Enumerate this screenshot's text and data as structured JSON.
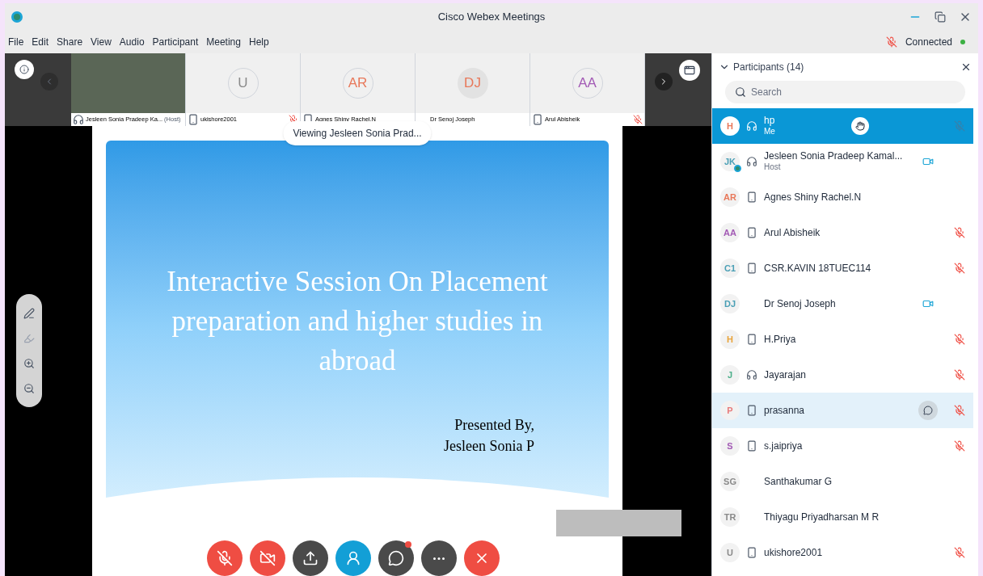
{
  "window": {
    "title": "Cisco Webex Meetings",
    "status": "Connected",
    "status_muted": true
  },
  "menu": [
    "File",
    "Edit",
    "Share",
    "View",
    "Audio",
    "Participant",
    "Meeting",
    "Help"
  ],
  "video_strip": [
    {
      "kind": "video",
      "name": "Jesleen Sonia Pradeep Ka...",
      "role": "(Host)",
      "headset": true,
      "phone": false,
      "muted": false
    },
    {
      "kind": "avatar",
      "initials": "U",
      "color": "#8a8a8a",
      "name": "ukishore2001",
      "headset": false,
      "phone": true,
      "muted": true
    },
    {
      "kind": "avatar",
      "initials": "AR",
      "color": "#e8785a",
      "name": "Agnes Shiny Rachel.N",
      "headset": false,
      "phone": true,
      "muted": false
    },
    {
      "kind": "avatar",
      "initials": "DJ",
      "color": "#e8785a",
      "name": "Dr Senoj Joseph",
      "headset": false,
      "phone": false,
      "muted": false
    },
    {
      "kind": "avatar",
      "initials": "AA",
      "color": "#a35bb5",
      "name": "Arul Abisheik",
      "headset": false,
      "phone": true,
      "muted": true
    }
  ],
  "viewing_label": "Viewing Jesleen Sonia Prad...",
  "slide": {
    "title": "Interactive Session On Placement preparation and higher studies in abroad",
    "presenter": [
      "Presented By,",
      "Jesleen Sonia P"
    ]
  },
  "toolbar": [
    {
      "kind": "mute"
    },
    {
      "kind": "video"
    },
    {
      "kind": "share"
    },
    {
      "kind": "participants"
    },
    {
      "kind": "chat",
      "notification": true
    },
    {
      "kind": "more"
    },
    {
      "kind": "leave"
    }
  ],
  "participants": {
    "title": "Participants (14)",
    "expanded": true,
    "search": {
      "placeholder": "Search"
    },
    "items": [
      {
        "initials": "H",
        "color": "#e8785a",
        "name": "hp",
        "subtitle": "Me",
        "headset": true,
        "phone": false,
        "presenter": false,
        "muted": true,
        "video": false,
        "hand_raised": true,
        "chat": false,
        "selected": true,
        "highlighted": false
      },
      {
        "initials": "JK",
        "color": "#4a9fb5",
        "name": "Jesleen Sonia Pradeep Kamal...",
        "subtitle": "Host",
        "headset": true,
        "phone": false,
        "presenter": true,
        "muted": false,
        "video": true,
        "hand_raised": false,
        "chat": false,
        "selected": false,
        "highlighted": false
      },
      {
        "initials": "AR",
        "color": "#e8785a",
        "name": "Agnes Shiny Rachel.N",
        "headset": false,
        "phone": true,
        "presenter": false,
        "muted": false,
        "video": false,
        "hand_raised": false,
        "chat": false,
        "selected": false,
        "highlighted": false
      },
      {
        "initials": "AA",
        "color": "#a35bb5",
        "name": "Arul Abisheik",
        "headset": false,
        "phone": true,
        "presenter": false,
        "muted": true,
        "video": false,
        "hand_raised": false,
        "chat": false,
        "selected": false,
        "highlighted": false
      },
      {
        "initials": "C1",
        "color": "#4a9fb5",
        "name": "CSR.KAVIN 18TUEC114",
        "headset": false,
        "phone": true,
        "presenter": false,
        "muted": true,
        "video": false,
        "hand_raised": false,
        "chat": false,
        "selected": false,
        "highlighted": false
      },
      {
        "initials": "DJ",
        "color": "#4a9fb5",
        "name": "Dr Senoj Joseph",
        "headset": false,
        "phone": false,
        "presenter": false,
        "muted": false,
        "video": true,
        "hand_raised": false,
        "chat": false,
        "selected": false,
        "highlighted": false
      },
      {
        "initials": "H",
        "color": "#e8a33a",
        "name": "H.Priya",
        "headset": false,
        "phone": true,
        "presenter": false,
        "muted": true,
        "video": false,
        "hand_raised": false,
        "chat": false,
        "selected": false,
        "highlighted": false
      },
      {
        "initials": "J",
        "color": "#4caf8a",
        "name": "Jayarajan",
        "headset": true,
        "phone": false,
        "presenter": false,
        "muted": true,
        "video": false,
        "hand_raised": false,
        "chat": false,
        "selected": false,
        "highlighted": false
      },
      {
        "initials": "P",
        "color": "#e87a7a",
        "name": "prasanna",
        "headset": false,
        "phone": true,
        "presenter": false,
        "muted": true,
        "video": false,
        "hand_raised": false,
        "chat": true,
        "selected": false,
        "highlighted": true
      },
      {
        "initials": "S",
        "color": "#a35bb5",
        "name": "s.jaipriya",
        "headset": false,
        "phone": true,
        "presenter": false,
        "muted": true,
        "video": false,
        "hand_raised": false,
        "chat": false,
        "selected": false,
        "highlighted": false
      },
      {
        "initials": "SG",
        "color": "#8a8a8a",
        "name": "Santhakumar G",
        "headset": false,
        "phone": false,
        "presenter": false,
        "muted": false,
        "video": false,
        "hand_raised": false,
        "chat": false,
        "selected": false,
        "highlighted": false
      },
      {
        "initials": "TR",
        "color": "#8a8a8a",
        "name": "Thiyagu Priyadharsan M R",
        "headset": false,
        "phone": false,
        "presenter": false,
        "muted": false,
        "video": false,
        "hand_raised": false,
        "chat": false,
        "selected": false,
        "highlighted": false
      },
      {
        "initials": "U",
        "color": "#8a8a8a",
        "name": "ukishore2001",
        "headset": false,
        "phone": true,
        "presenter": false,
        "muted": true,
        "video": false,
        "hand_raised": false,
        "chat": false,
        "selected": false,
        "highlighted": false
      }
    ]
  }
}
